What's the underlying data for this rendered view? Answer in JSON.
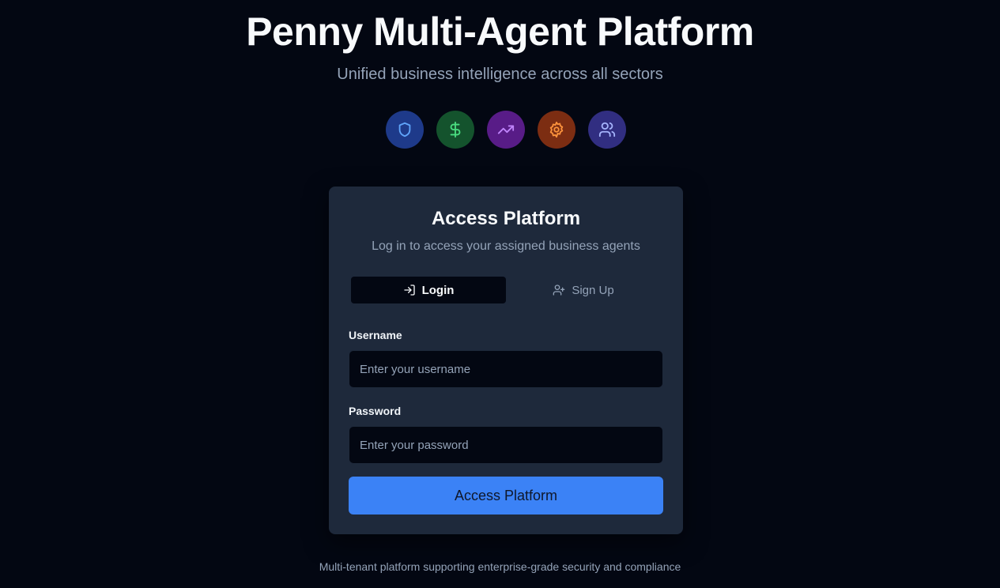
{
  "header": {
    "title": "Penny Multi-Agent Platform",
    "subtitle": "Unified business intelligence across all sectors"
  },
  "sector_icons": [
    {
      "icon": "shield-icon",
      "bg": "#1e3a8a",
      "fg": "#60a5fa"
    },
    {
      "icon": "dollar-icon",
      "bg": "#14532d",
      "fg": "#4ade80"
    },
    {
      "icon": "trending-up-icon",
      "bg": "#581c87",
      "fg": "#c084fc"
    },
    {
      "icon": "gear-icon",
      "bg": "#7c2d12",
      "fg": "#fb923c"
    },
    {
      "icon": "users-icon",
      "bg": "#312e81",
      "fg": "#a5b4fc"
    }
  ],
  "card": {
    "title": "Access Platform",
    "subtitle": "Log in to access your assigned business agents",
    "tabs": [
      {
        "label": "Login",
        "icon": "log-in-icon",
        "active": true
      },
      {
        "label": "Sign Up",
        "icon": "user-plus-icon",
        "active": false
      }
    ],
    "username": {
      "label": "Username",
      "value": "",
      "placeholder": "Enter your username"
    },
    "password": {
      "label": "Password",
      "value": "",
      "placeholder": "Enter your password"
    },
    "submit_label": "Access Platform"
  },
  "footer": {
    "note": "Multi-tenant platform supporting enterprise-grade security and compliance"
  },
  "colors": {
    "background": "#030712",
    "card": "#1e293b",
    "accent": "#3b82f6",
    "muted_text": "#94a3b8"
  }
}
